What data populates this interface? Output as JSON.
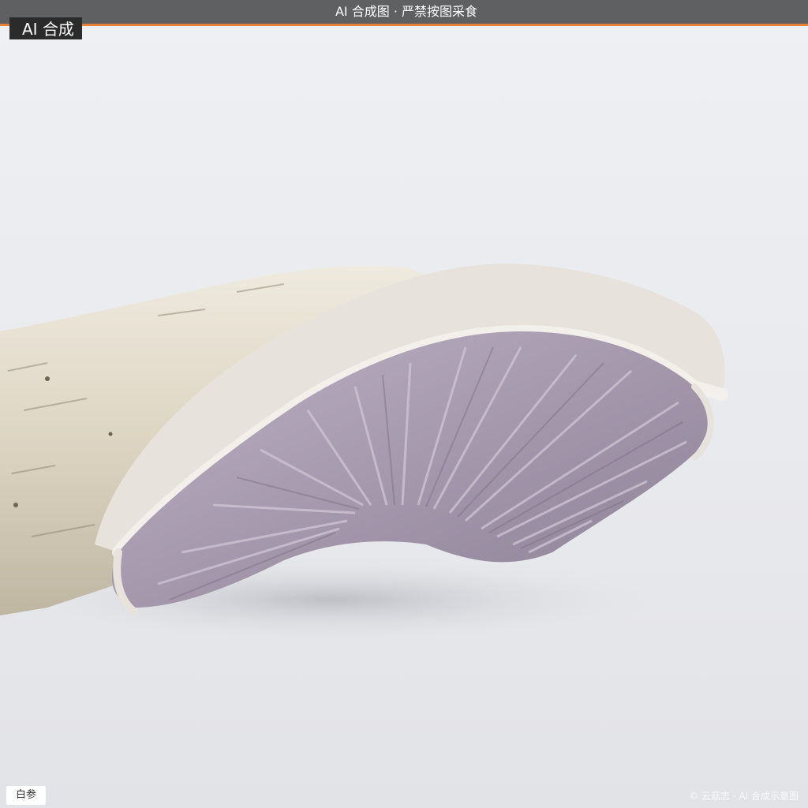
{
  "banner": {
    "mark": "",
    "text": "AI 合成图 · 严禁按图采食"
  },
  "corner_tag": {
    "mark": "",
    "text": "AI 合成"
  },
  "name_label": "白参",
  "watermark": "© 云菇志 · AI 合成示意图",
  "colors": {
    "background": "#e9eaee",
    "banner_bg": "#5f6062",
    "banner_accent": "#e0803a",
    "gills": "#a89caf",
    "fuzz": "#e6e2dc",
    "wood": "#ddd6c4"
  }
}
